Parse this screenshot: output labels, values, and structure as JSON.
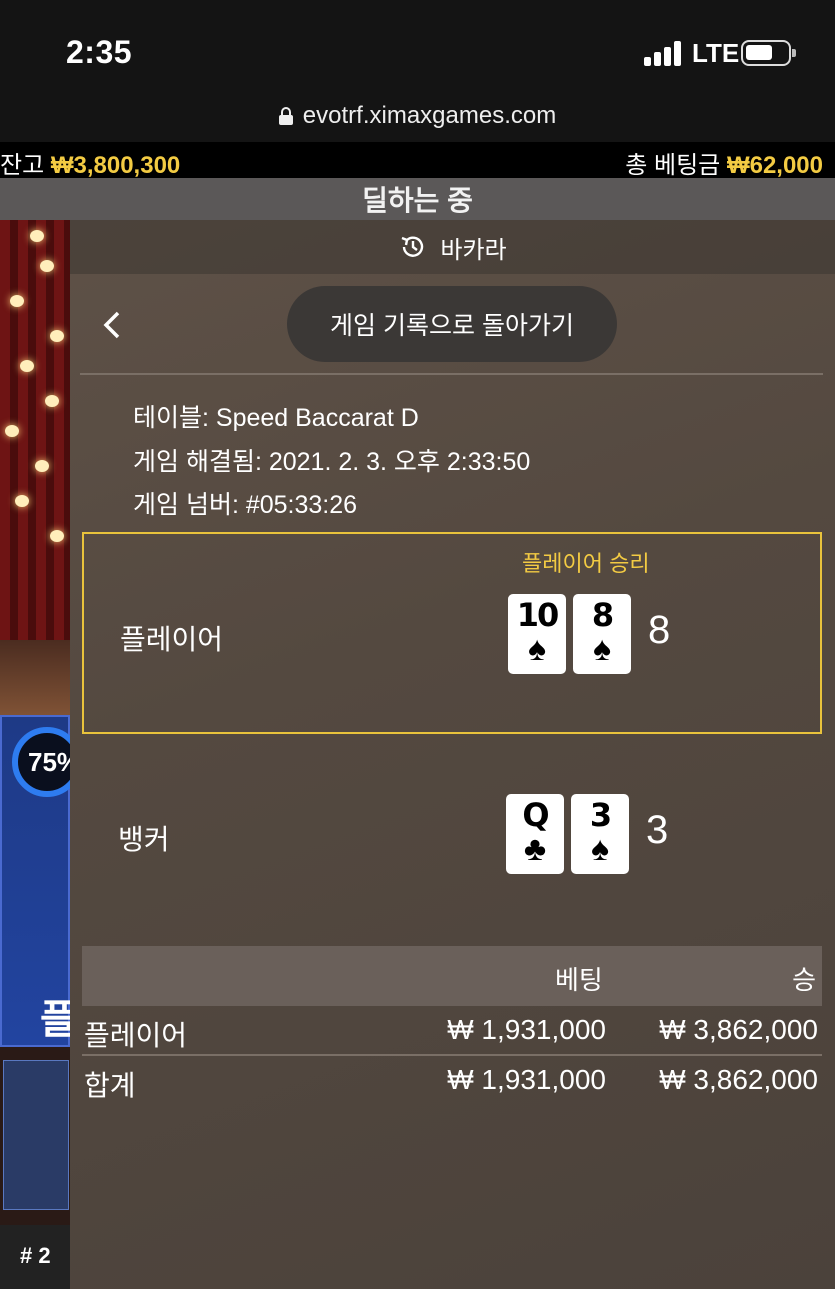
{
  "status_bar": {
    "time": "2:35",
    "network": "LTE"
  },
  "browser": {
    "url": "evotrf.ximaxgames.com"
  },
  "balance_bar": {
    "balance_label": "잔고",
    "balance_value": "₩3,800,300",
    "total_bet_label": "총 베팅금",
    "total_bet_value": "₩62,000"
  },
  "dealing_status": "딜하는 중",
  "scene": {
    "timer_text": "75%",
    "label_fragment": "플",
    "row_hash": "# 2"
  },
  "panel": {
    "title": "바카라",
    "back_button_label": "게임 기록으로 돌아가기",
    "info": {
      "table": "테이블: Speed Baccarat D",
      "resolved": "게임 해결됨: 2021. 2. 3. 오후 2:33:50",
      "game_number": "게임 넘버: #05:33:26"
    },
    "player": {
      "label": "플레이어",
      "result_label": "플레이어 승리",
      "cards": [
        {
          "rank": "10",
          "suit": "♠"
        },
        {
          "rank": "8",
          "suit": "♠"
        }
      ],
      "score": "8"
    },
    "banker": {
      "label": "뱅커",
      "cards": [
        {
          "rank": "Q",
          "suit": "♣"
        },
        {
          "rank": "3",
          "suit": "♠"
        }
      ],
      "score": "3"
    },
    "bets": {
      "headers": {
        "bet": "베팅",
        "win": "승"
      },
      "rows": [
        {
          "name": "플레이어",
          "bet": "₩ 1,931,000",
          "win": "₩ 3,862,000"
        },
        {
          "name": "합계",
          "bet": "₩ 1,931,000",
          "win": "₩ 3,862,000"
        }
      ]
    }
  },
  "colors": {
    "gold": "#f3cb43",
    "panel_bg": "#554a41",
    "win_border": "#e9c33c"
  }
}
